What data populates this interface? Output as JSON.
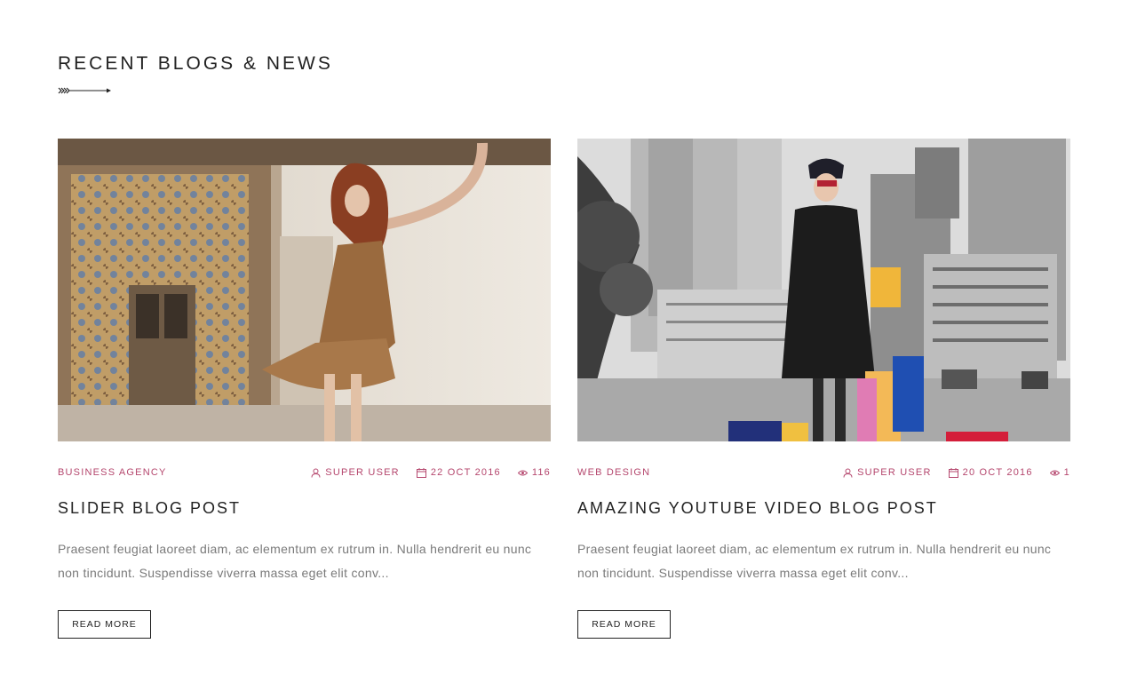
{
  "section": {
    "title": "RECENT BLOGS & NEWS"
  },
  "colors": {
    "accent": "#b5476e",
    "heading": "#222222",
    "body_text": "#7a7a7a"
  },
  "posts": [
    {
      "category": "BUSINESS AGENCY",
      "author": "SUPER USER",
      "date": "22 OCT 2016",
      "views": "116",
      "title": "SLIDER BLOG POST",
      "excerpt": "Praesent feugiat laoreet diam, ac elementum ex rutrum in. Nulla hendrerit eu nunc non tincidunt. Suspendisse viverra massa eget elit conv...",
      "read_more": "READ MORE"
    },
    {
      "category": "WEB DESIGN",
      "author": "SUPER USER",
      "date": "20 OCT 2016",
      "views": "1",
      "title": "AMAZING YOUTUBE VIDEO BLOG POST",
      "excerpt": "Praesent feugiat laoreet diam, ac elementum ex rutrum in. Nulla hendrerit eu nunc non tincidunt. Suspendisse viverra massa eget elit conv...",
      "read_more": "READ MORE"
    }
  ],
  "icons": {
    "title_decoration": "arrow-decoration-icon",
    "author": "user-icon",
    "date": "calendar-icon",
    "views": "eye-icon"
  }
}
